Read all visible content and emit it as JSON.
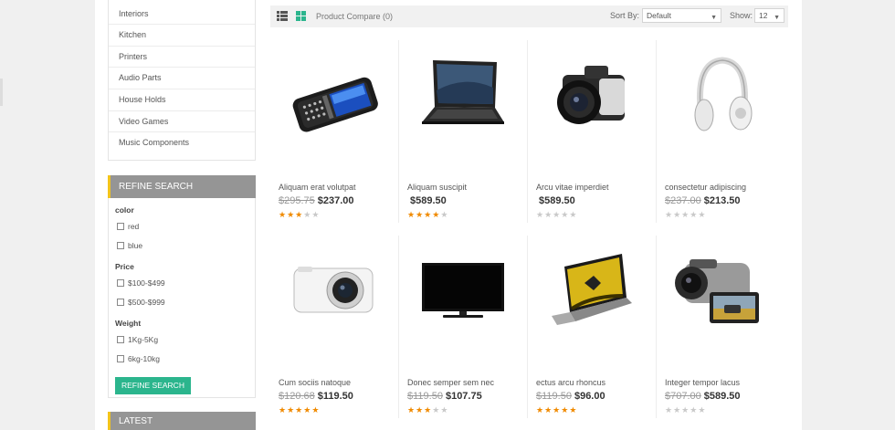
{
  "sidebar": {
    "categories": [
      "Interiors",
      "Kitchen",
      "Printers",
      "Audio Parts",
      "House Holds",
      "Video Games",
      "Music Components"
    ],
    "refine": {
      "title": "REFINE SEARCH",
      "groups": [
        {
          "title": "color",
          "options": [
            "red",
            "blue"
          ]
        },
        {
          "title": "Price",
          "options": [
            "$100-$499",
            "$500-$999"
          ]
        },
        {
          "title": "Weight",
          "options": [
            "1Kg-5Kg",
            "6kg-10kg"
          ]
        }
      ],
      "button": "REFINE SEARCH"
    },
    "latest_title": "LATEST"
  },
  "toolbar": {
    "compare": "Product Compare (0)",
    "sort_label": "Sort By:",
    "sort_value": "Default",
    "show_label": "Show:",
    "show_value": "12"
  },
  "products": [
    {
      "name": "Aliquam erat volutpat",
      "old": "$295.75",
      "price": "$237.00",
      "rating": 3,
      "icon": "phone"
    },
    {
      "name": "Aliquam suscipit",
      "old": "",
      "price": "$589.50",
      "rating": 4,
      "icon": "laptop"
    },
    {
      "name": "Arcu vitae imperdiet",
      "old": "",
      "price": "$589.50",
      "rating": 0,
      "icon": "camera"
    },
    {
      "name": "consectetur adipiscing",
      "old": "$237.00",
      "price": "$213.50",
      "rating": 0,
      "icon": "headphones"
    },
    {
      "name": "Cum sociis natoque",
      "old": "$120.68",
      "price": "$119.50",
      "rating": 5,
      "icon": "compact-camera"
    },
    {
      "name": "Donec semper sem nec",
      "old": "$119.50",
      "price": "$107.75",
      "rating": 3,
      "icon": "monitor"
    },
    {
      "name": "ectus arcu rhoncus",
      "old": "$119.50",
      "price": "$96.00",
      "rating": 5,
      "icon": "laptop-yellow"
    },
    {
      "name": "Integer tempor lacus",
      "old": "$707.00",
      "price": "$589.50",
      "rating": 0,
      "icon": "camcorder"
    }
  ],
  "colors": {
    "accent": "#f3c41b",
    "button": "#2bb58d",
    "panel_head": "#959595",
    "star_on": "#f08a00",
    "star_off": "#c9c9c9"
  }
}
